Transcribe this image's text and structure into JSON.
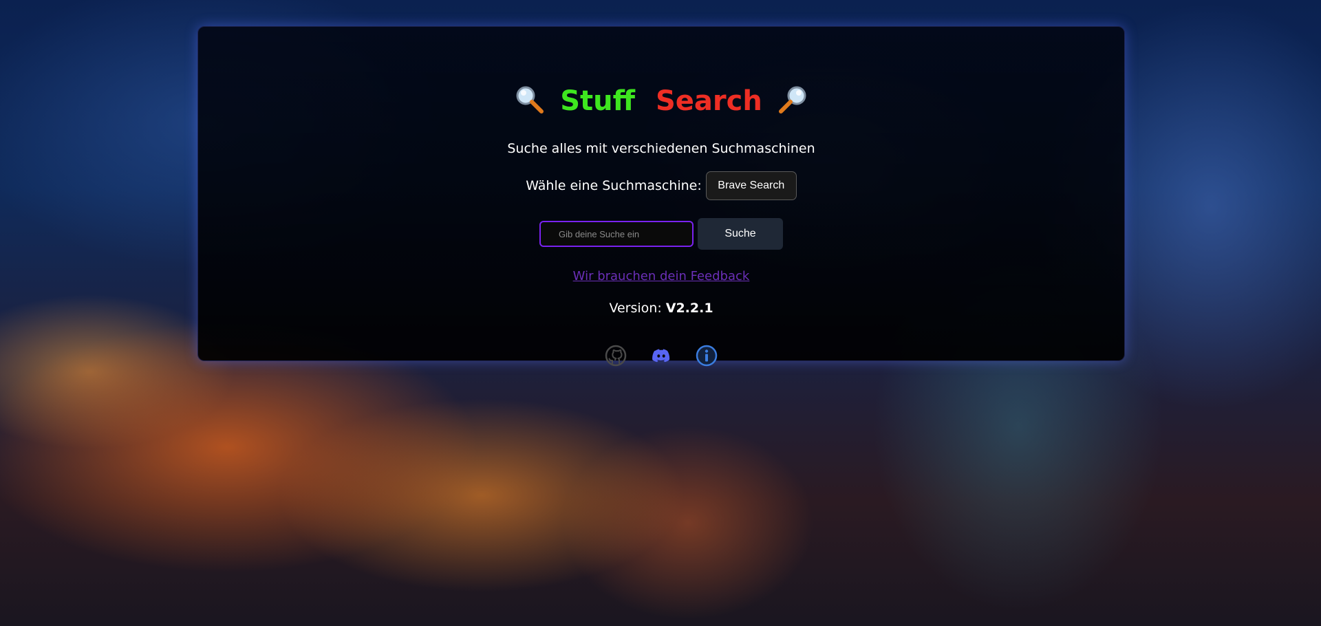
{
  "header": {
    "title_left_word": "Stuff",
    "title_right_word": "Search",
    "subtitle": "Suche alles mit verschiedenen Suchmaschinen"
  },
  "engine_picker": {
    "label": "Wähle eine Suchmaschine:",
    "selected": "Brave Search"
  },
  "search": {
    "placeholder": "Gib deine Suche ein",
    "value": "",
    "button_label": "Suche"
  },
  "feedback_link": "Wir brauchen dein Feedback",
  "version": {
    "label": "Version:",
    "value": "V2.2.1"
  },
  "footer_icons": [
    "github-icon",
    "discord-icon",
    "info-icon"
  ],
  "colors": {
    "title_left": "#3ee61f",
    "title_right": "#ee2e24",
    "input_border": "#7a22f0",
    "link": "#6b2fb8",
    "discord": "#5865f2",
    "info": "#3b7de0"
  }
}
